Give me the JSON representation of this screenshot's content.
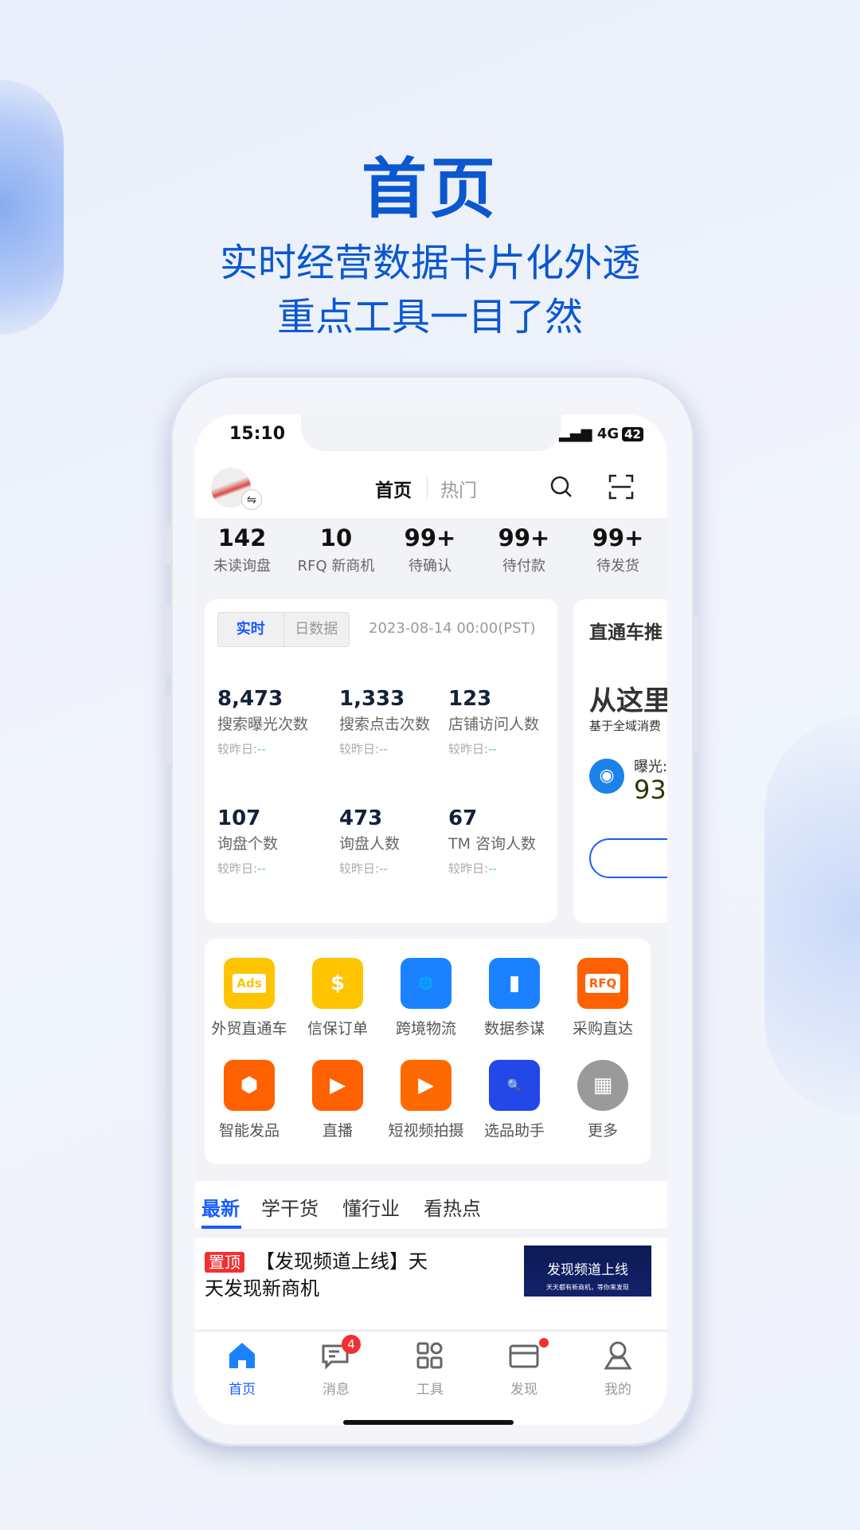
{
  "promo": {
    "title": "首页",
    "line1": "实时经营数据卡片化外透",
    "line2": "重点工具一目了然"
  },
  "status": {
    "time": "15:10",
    "network": "4G",
    "battery": "42"
  },
  "header": {
    "tabs": [
      "首页",
      "热门"
    ],
    "active_tab": "首页"
  },
  "stats": [
    {
      "value": "142",
      "label": "未读询盘"
    },
    {
      "value": "10",
      "label": "RFQ 新商机"
    },
    {
      "value": "99+",
      "label": "待确认"
    },
    {
      "value": "99+",
      "label": "待付款"
    },
    {
      "value": "99+",
      "label": "待发货"
    }
  ],
  "data_card": {
    "segments": [
      "实时",
      "日数据"
    ],
    "active_segment": "实时",
    "date": "2023-08-14 00:00(PST)",
    "compare_label": "较昨日:",
    "compare_value": "--",
    "metrics": [
      {
        "value": "8,473",
        "label": "搜索曝光次数"
      },
      {
        "value": "1,333",
        "label": "搜索点击次数"
      },
      {
        "value": "123",
        "label": "店铺访问人数"
      },
      {
        "value": "107",
        "label": "询盘个数"
      },
      {
        "value": "473",
        "label": "询盘人数"
      },
      {
        "value": "67",
        "label": "TM 咨询人数"
      }
    ]
  },
  "promo_card": {
    "title": "直通车推",
    "headline": "从这里",
    "sub": "基于全域消费",
    "exposure_label": "曝光:",
    "exposure_value": "93"
  },
  "tools": [
    {
      "label": "外贸直通车",
      "icon": "ads-icon",
      "color": "#ffc400",
      "glyph": "Ads"
    },
    {
      "label": "信保订单",
      "icon": "trade-assurance-icon",
      "color": "#ffc400",
      "glyph": "$"
    },
    {
      "label": "跨境物流",
      "icon": "globe-logistics-icon",
      "color": "#1a82ff",
      "glyph": "🌐"
    },
    {
      "label": "数据参谋",
      "icon": "bar-chart-icon",
      "color": "#1a82ff",
      "glyph": "▮"
    },
    {
      "label": "采购直达",
      "icon": "rfq-icon",
      "color": "#ff6000",
      "glyph": "RFQ"
    },
    {
      "label": "智能发品",
      "icon": "cube-icon",
      "color": "#ff6000",
      "glyph": "⬢"
    },
    {
      "label": "直播",
      "icon": "live-tv-icon",
      "color": "#ff6000",
      "glyph": "▶"
    },
    {
      "label": "短视频拍摄",
      "icon": "video-camera-icon",
      "color": "#ff6a00",
      "glyph": "▶"
    },
    {
      "label": "选品助手",
      "icon": "shopping-bag-search-icon",
      "color": "#2447e8",
      "glyph": "🔍"
    },
    {
      "label": "更多",
      "icon": "more-grid-icon",
      "color": "#9a9a9a",
      "glyph": "▦"
    }
  ],
  "content_tabs": [
    "最新",
    "学干货",
    "懂行业",
    "看热点"
  ],
  "active_content_tab": "最新",
  "article": {
    "badge": "置顶",
    "title": "【发现频道上线】天天发现新商机",
    "thumb_title": "发现频道上线",
    "thumb_sub": "天天都有新商机，等你来发现"
  },
  "nav": [
    {
      "label": "首页",
      "active": true
    },
    {
      "label": "消息",
      "badge": "4"
    },
    {
      "label": "工具"
    },
    {
      "label": "发现",
      "dot": true
    },
    {
      "label": "我的"
    }
  ],
  "colors": {
    "accent": "#1a5cff",
    "promo": "#0a57d0",
    "badge": "#f23030"
  }
}
